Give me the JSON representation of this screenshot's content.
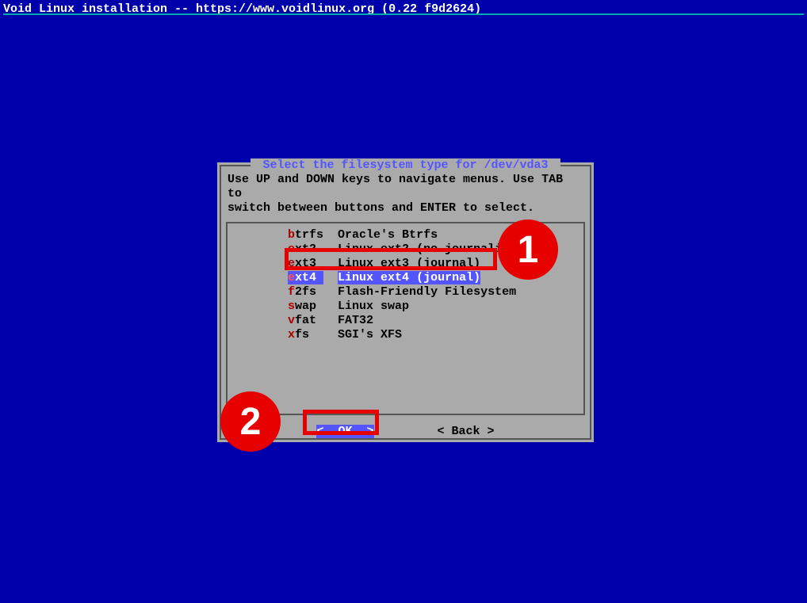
{
  "header": {
    "title": "Void Linux installation -- https://www.voidlinux.org (0.22 f9d2624)"
  },
  "dialog": {
    "title": " Select the filesystem type for /dev/vda3 ",
    "instructions": "Use UP and DOWN keys to navigate menus. Use TAB to\nswitch between buttons and ENTER to select.",
    "items": [
      {
        "hl": "b",
        "rest": "trfs",
        "desc": "Oracle's Btrfs",
        "selected": false
      },
      {
        "hl": "e",
        "rest": "xt2",
        "desc": "Linux ext2 (no journaling)",
        "selected": false
      },
      {
        "hl": "e",
        "rest": "xt3",
        "desc": "Linux ext3 (journal)",
        "selected": false
      },
      {
        "hl": "e",
        "rest": "xt4",
        "desc": "Linux ext4 (journal)",
        "selected": true
      },
      {
        "hl": "f",
        "rest": "2fs",
        "desc": "Flash-Friendly Filesystem",
        "selected": false
      },
      {
        "hl": "s",
        "rest": "wap",
        "desc": "Linux swap",
        "selected": false
      },
      {
        "hl": "v",
        "rest": "fat",
        "desc": "FAT32",
        "selected": false
      },
      {
        "hl": "x",
        "rest": "fs",
        "desc": "SGI's XFS",
        "selected": false
      }
    ],
    "buttons": {
      "ok": "<  OK  >",
      "back": "< Back >"
    }
  },
  "annotations": {
    "marker1": "1",
    "marker2": "2"
  }
}
